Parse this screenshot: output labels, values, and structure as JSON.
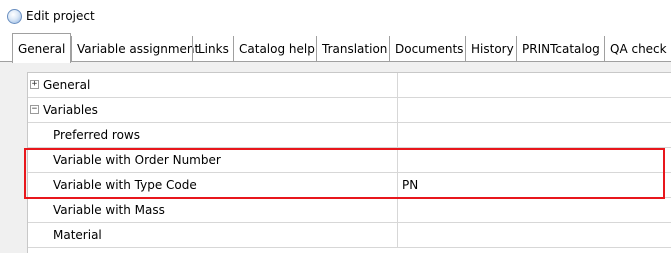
{
  "window": {
    "title": "Edit project",
    "icon": "app-globe-icon"
  },
  "tabs": [
    {
      "label": "General",
      "active": true
    },
    {
      "label": "Variable assignment",
      "active": false
    },
    {
      "label": "Links",
      "active": false
    },
    {
      "label": "Catalog help",
      "active": false
    },
    {
      "label": "Translation",
      "active": false
    },
    {
      "label": "Documents",
      "active": false
    },
    {
      "label": "History",
      "active": false
    },
    {
      "label": "PRINTcatalog",
      "active": false
    },
    {
      "label": "QA check",
      "active": false
    }
  ],
  "grid": {
    "rows": [
      {
        "label": "General",
        "type": "group",
        "expander": "+",
        "value": ""
      },
      {
        "label": "Variables",
        "type": "group",
        "expander": "−",
        "value": ""
      },
      {
        "label": "Preferred rows",
        "type": "item",
        "value": ""
      },
      {
        "label": "Variable with Order Number",
        "type": "item",
        "value": ""
      },
      {
        "label": "Variable with Type Code",
        "type": "item",
        "value": "PN"
      },
      {
        "label": "Variable with Mass",
        "type": "item",
        "value": ""
      },
      {
        "label": "Material",
        "type": "item",
        "value": ""
      }
    ]
  },
  "highlight": {
    "color": "#e8171c"
  }
}
